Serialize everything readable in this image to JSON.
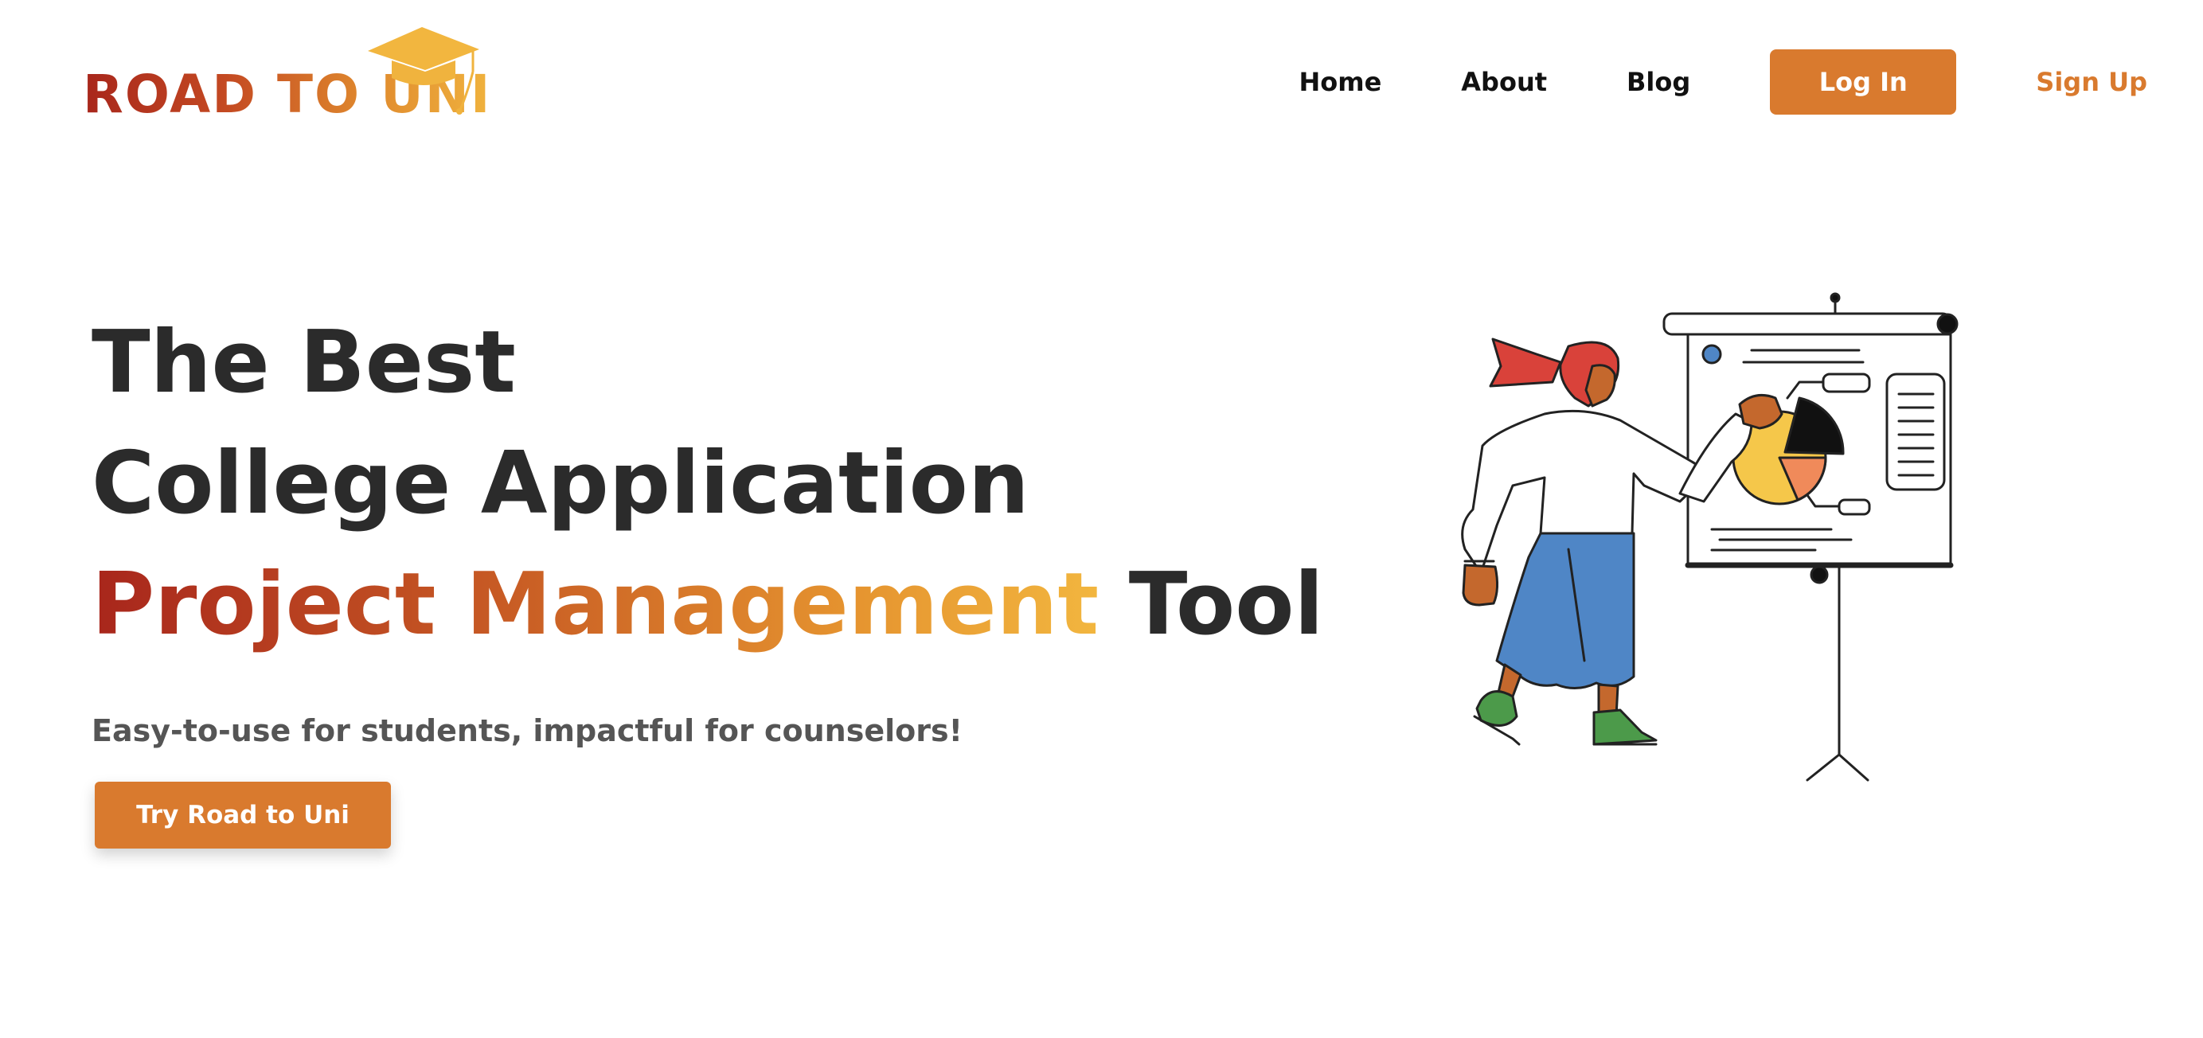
{
  "logo": {
    "text": "ROAD TO UNI",
    "icon": "graduation-cap-icon"
  },
  "nav": {
    "home": "Home",
    "about": "About",
    "blog": "Blog",
    "login": "Log In",
    "signup": "Sign Up"
  },
  "hero": {
    "line1": "The Best",
    "line2": "College Application",
    "line3_highlight": "Project Management",
    "line3_rest": "Tool",
    "subtitle": "Easy-to-use for students, impactful for counselors!",
    "cta": "Try Road to Uni"
  },
  "colors": {
    "accent": "#d97a2e",
    "gradient_start": "#a8261c",
    "gradient_end": "#f2b63f",
    "heading": "#2b2b2b",
    "subtitle": "#555555"
  }
}
